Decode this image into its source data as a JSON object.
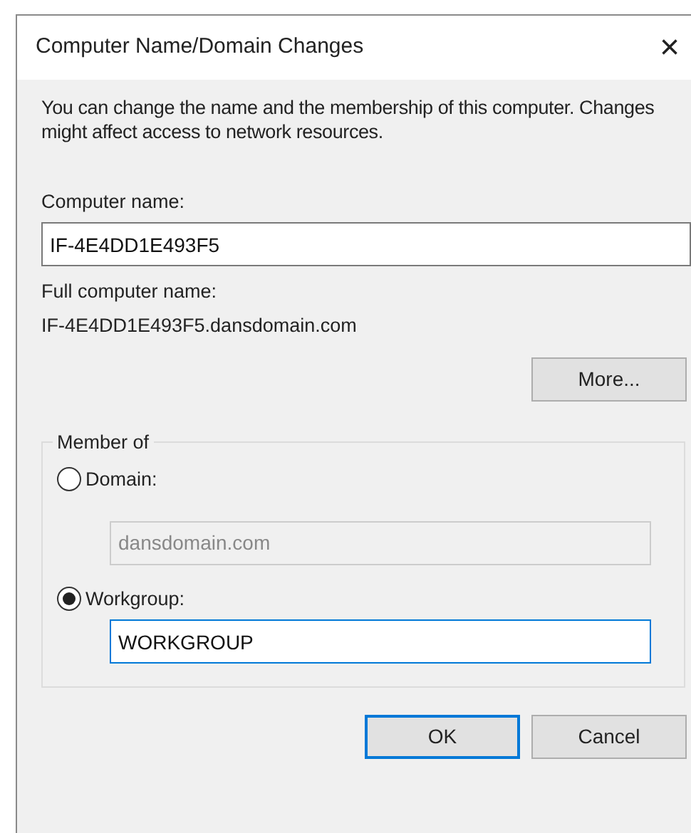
{
  "window": {
    "title": "Computer Name/Domain Changes",
    "close": "×"
  },
  "description": "You can change the name and the membership of this computer. Changes might affect access to network resources.",
  "computer_name": {
    "label": "Computer name:",
    "value": "IF-4E4DD1E493F5"
  },
  "full_computer_name": {
    "label": "Full computer name:",
    "value": "IF-4E4DD1E493F5.dansdomain.com"
  },
  "more_button": "More...",
  "member_of": {
    "legend": "Member of",
    "options": [
      {
        "label": "Domain:",
        "selected": false,
        "value": "dansdomain.com",
        "disabled": true,
        "focused": false
      },
      {
        "label": "Workgroup:",
        "selected": true,
        "value": "WORKGROUP",
        "disabled": false,
        "focused": true
      }
    ]
  },
  "buttons": [
    {
      "label": "OK",
      "default": true
    },
    {
      "label": "Cancel",
      "default": false
    }
  ]
}
